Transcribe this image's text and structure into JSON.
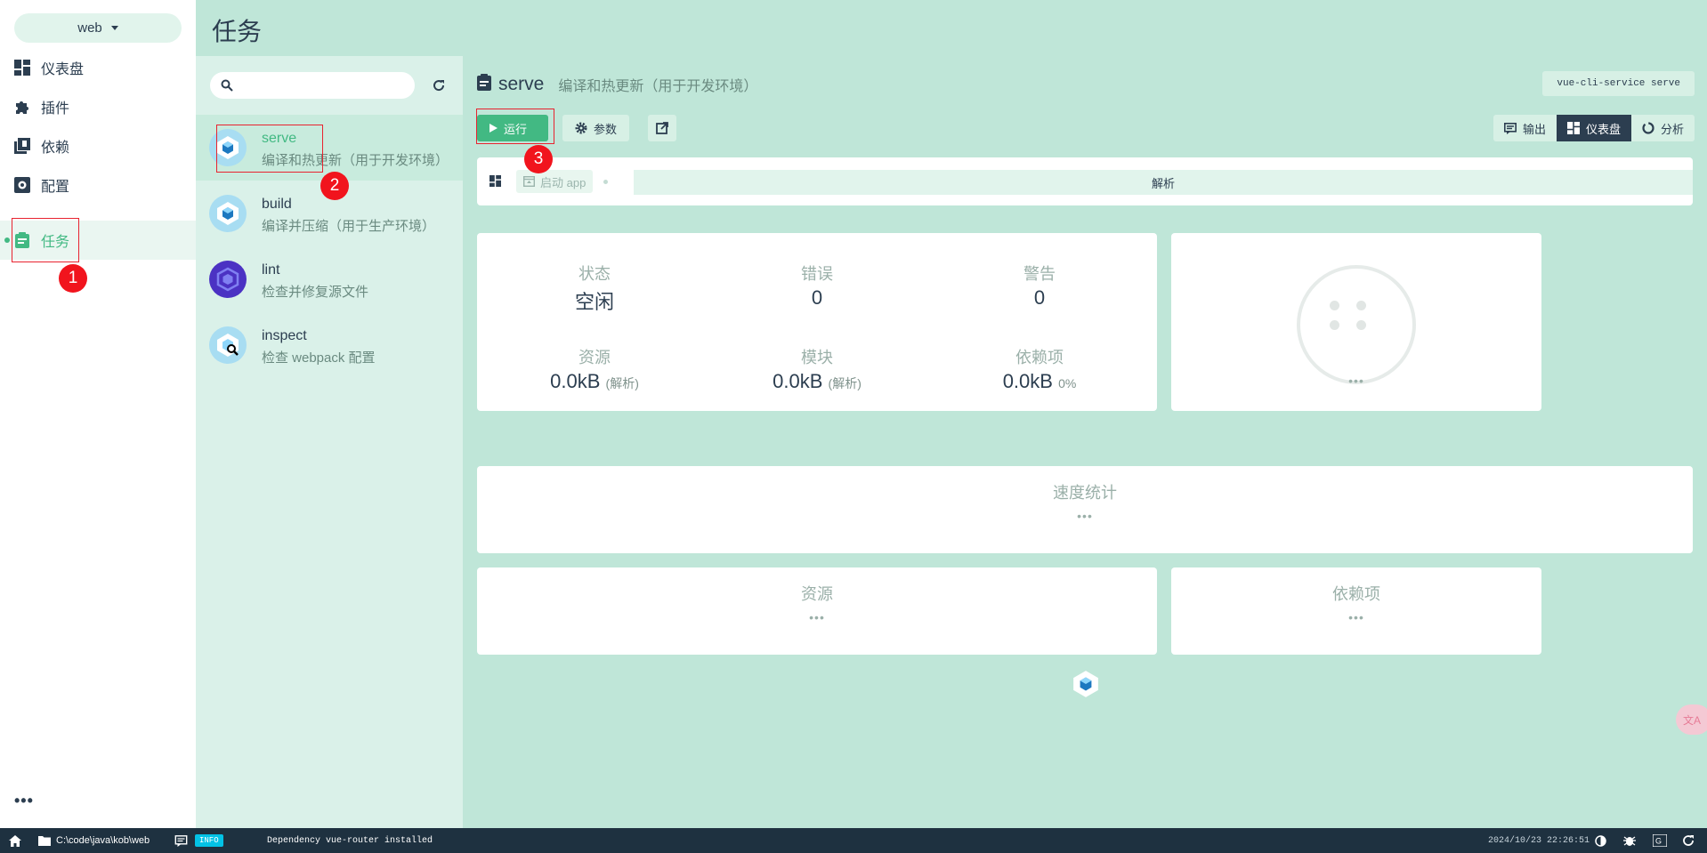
{
  "nav": {
    "project": "web",
    "items": [
      {
        "label": "仪表盘",
        "icon": "dashboard-icon"
      },
      {
        "label": "插件",
        "icon": "puzzle-icon"
      },
      {
        "label": "依赖",
        "icon": "library-icon"
      },
      {
        "label": "配置",
        "icon": "settings-box-icon"
      },
      {
        "label": "任务",
        "icon": "clipboard-icon",
        "active": true
      }
    ],
    "more": "•••"
  },
  "header": {
    "title": "任务"
  },
  "tasklist": {
    "search_placeholder": "",
    "tasks": [
      {
        "name": "serve",
        "desc": "编译和热更新（用于开发环境）",
        "selected": true,
        "icon": "webpack-icon"
      },
      {
        "name": "build",
        "desc": "编译并压缩（用于生产环境）",
        "icon": "webpack-icon"
      },
      {
        "name": "lint",
        "desc": "检查并修复源文件",
        "icon": "eslint-icon"
      },
      {
        "name": "inspect",
        "desc": "检查 webpack 配置",
        "icon": "webpack-inspect-icon"
      }
    ]
  },
  "task": {
    "name": "serve",
    "desc": "编译和热更新（用于开发环境）",
    "command": "vue-cli-service serve",
    "run_label": "运行",
    "params_label": "参数",
    "view_tabs": [
      {
        "label": "输出",
        "icon": "output-icon"
      },
      {
        "label": "仪表盘",
        "icon": "dashboard-icon",
        "active": true
      },
      {
        "label": "分析",
        "icon": "analyze-icon"
      }
    ]
  },
  "panel": {
    "start_app": "启动 app",
    "analyze": "解析"
  },
  "stats": {
    "status": {
      "label": "状态",
      "value": "空闲"
    },
    "errors": {
      "label": "错误",
      "value": "0"
    },
    "warnings": {
      "label": "警告",
      "value": "0"
    },
    "assets": {
      "label": "资源",
      "value": "0.0kB",
      "note": "(解析)"
    },
    "modules": {
      "label": "模块",
      "value": "0.0kB",
      "note": "(解析)"
    },
    "deps": {
      "label": "依赖项",
      "value": "0.0kB",
      "note": "0%"
    },
    "side_dots": "•••"
  },
  "speed": {
    "title": "速度统计",
    "dots": "•••"
  },
  "assets_card": {
    "title": "资源",
    "dots": "•••"
  },
  "deps_card": {
    "title": "依赖项",
    "dots": "•••"
  },
  "statusbar": {
    "path": "C:\\code\\java\\kob\\web",
    "badge": "INFO",
    "message": "Dependency vue-router installed",
    "time": "2024/10/23 22:26:51"
  },
  "translate_widget": "文A",
  "annotations": [
    "1",
    "2",
    "3"
  ],
  "colors": {
    "accent": "#42b983",
    "navy": "#2c3e50",
    "annotation": "#f1141d"
  }
}
